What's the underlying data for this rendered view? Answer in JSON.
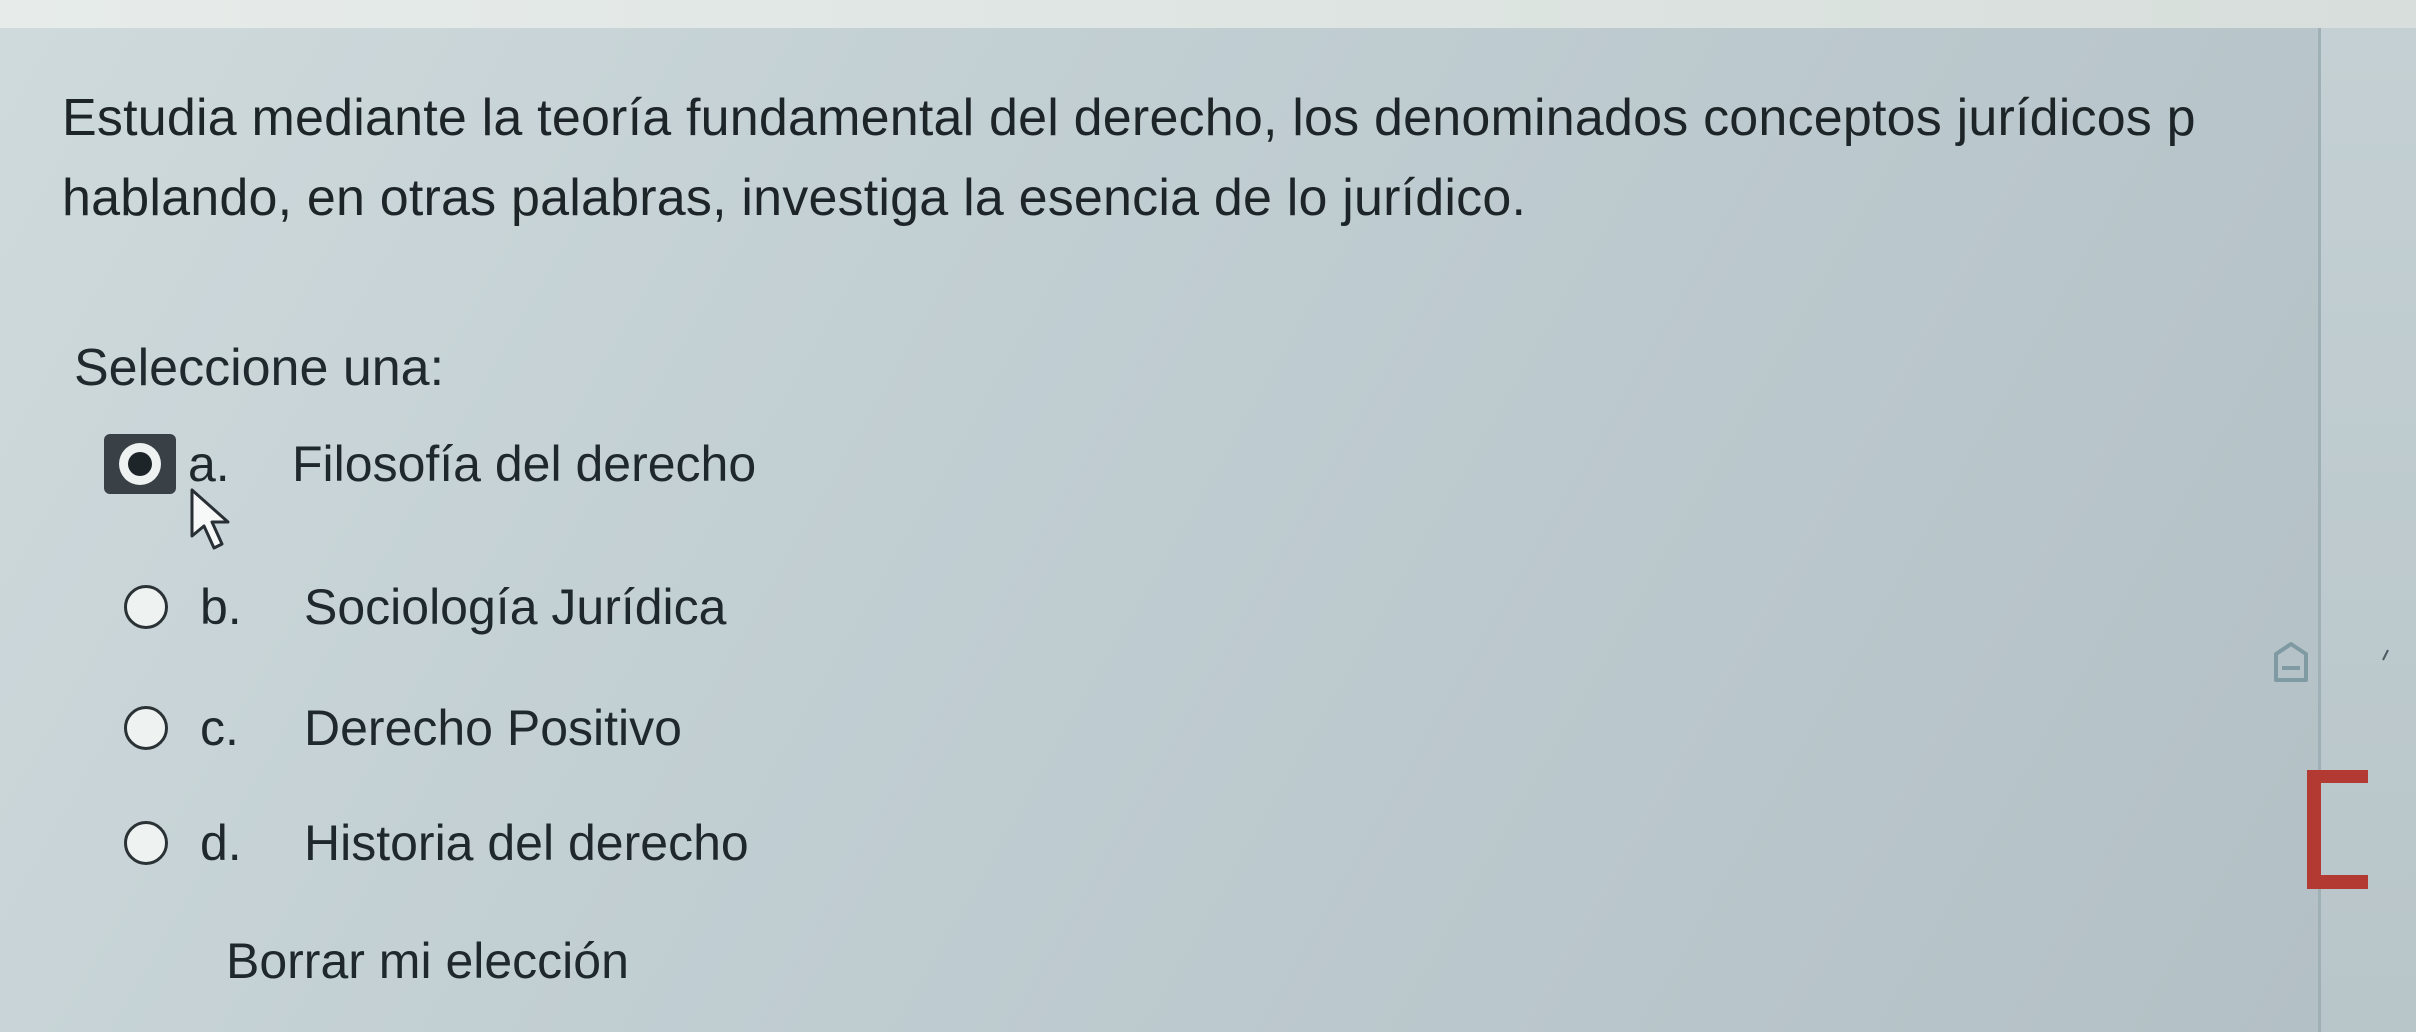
{
  "question": {
    "line1": "Estudia mediante la teoría fundamental del derecho, los denominados conceptos jurídicos p",
    "line2": "hablando, en otras palabras, investiga la esencia de lo jurídico."
  },
  "prompt": "Seleccione una:",
  "options": [
    {
      "letter": "a.",
      "label": "Filosofía del derecho",
      "selected": true
    },
    {
      "letter": "b.",
      "label": "Sociología Jurídica",
      "selected": false
    },
    {
      "letter": "c.",
      "label": "Derecho Positivo",
      "selected": false
    },
    {
      "letter": "d.",
      "label": "Historia del derecho",
      "selected": false
    }
  ],
  "clear_choice": "Borrar mi elección",
  "icons": {
    "cursor": "mouse-pointer-icon",
    "side": "flag-outline-icon",
    "bracket": "bracket-icon"
  },
  "colors": {
    "accent": "#b23a33",
    "text": "#1f292d"
  }
}
